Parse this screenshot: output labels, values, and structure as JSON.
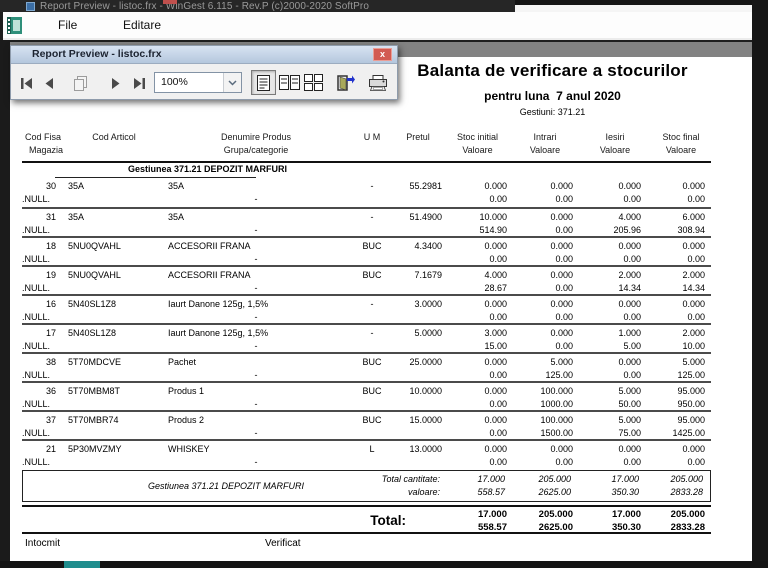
{
  "window": {
    "title": "Report Preview - listoc.frx - WinGest 6.115 - Rev.P  (c)2000-2020 SoftPro",
    "menu": [
      "File",
      "Editare"
    ]
  },
  "preview_toolbar": {
    "title": "Report Preview - listoc.frx",
    "close_label": "x",
    "zoom_value": "100%"
  },
  "report": {
    "title": "Balanta de verificare a stocurilor",
    "subtitle": "pentru luna  7 anul 2020",
    "gestiuni": "Gestiuni: 371.21",
    "header": {
      "row1": [
        "Cod Fisa",
        "Cod Articol",
        "Denumire Produs",
        "U M",
        "Pretul",
        "Stoc initial",
        "Intrari",
        "Iesiri",
        "Stoc final"
      ],
      "row2": [
        "Magazia",
        "",
        "Grupa/categorie",
        "",
        "",
        "Valoare",
        "Valoare",
        "Valoare",
        "Valoare"
      ]
    },
    "group_header": "Gestiunea 371.21  DEPOZIT MARFURI",
    "rows": [
      {
        "fisa": "30",
        "articol": "35A",
        "denumire": "35A",
        "um": "-",
        "pret": "55.2981",
        "si": "0.000",
        "intr": "0.000",
        "iesi": "0.000",
        "sf": "0.000",
        "magazia": ".NULL.",
        "grupa": "-",
        "vi": "0.00",
        "vin": "0.00",
        "vie": "0.00",
        "vsf": "0.00"
      },
      {
        "fisa": "31",
        "articol": "35A",
        "denumire": "35A",
        "um": "-",
        "pret": "51.4900",
        "si": "10.000",
        "intr": "0.000",
        "iesi": "4.000",
        "sf": "6.000",
        "magazia": ".NULL.",
        "grupa": "-",
        "vi": "514.90",
        "vin": "0.00",
        "vie": "205.96",
        "vsf": "308.94"
      },
      {
        "fisa": "18",
        "articol": "5NU0QVAHL",
        "denumire": "ACCESORII FRANA",
        "um": "BUC",
        "pret": "4.3400",
        "si": "0.000",
        "intr": "0.000",
        "iesi": "0.000",
        "sf": "0.000",
        "magazia": ".NULL.",
        "grupa": "-",
        "vi": "0.00",
        "vin": "0.00",
        "vie": "0.00",
        "vsf": "0.00"
      },
      {
        "fisa": "19",
        "articol": "5NU0QVAHL",
        "denumire": "ACCESORII FRANA",
        "um": "BUC",
        "pret": "7.1679",
        "si": "4.000",
        "intr": "0.000",
        "iesi": "2.000",
        "sf": "2.000",
        "magazia": ".NULL.",
        "grupa": "-",
        "vi": "28.67",
        "vin": "0.00",
        "vie": "14.34",
        "vsf": "14.34"
      },
      {
        "fisa": "16",
        "articol": "5N40SL1Z8",
        "denumire": "Iaurt Danone 125g, 1,5%",
        "um": "-",
        "pret": "3.0000",
        "si": "0.000",
        "intr": "0.000",
        "iesi": "0.000",
        "sf": "0.000",
        "magazia": ".NULL.",
        "grupa": "-",
        "vi": "0.00",
        "vin": "0.00",
        "vie": "0.00",
        "vsf": "0.00"
      },
      {
        "fisa": "17",
        "articol": "5N40SL1Z8",
        "denumire": "Iaurt Danone 125g, 1,5%",
        "um": "-",
        "pret": "5.0000",
        "si": "3.000",
        "intr": "0.000",
        "iesi": "1.000",
        "sf": "2.000",
        "magazia": ".NULL.",
        "grupa": "-",
        "vi": "15.00",
        "vin": "0.00",
        "vie": "5.00",
        "vsf": "10.00"
      },
      {
        "fisa": "38",
        "articol": "5T70MDCVE",
        "denumire": "Pachet",
        "um": "BUC",
        "pret": "25.0000",
        "si": "0.000",
        "intr": "5.000",
        "iesi": "0.000",
        "sf": "5.000",
        "magazia": ".NULL.",
        "grupa": "-",
        "vi": "0.00",
        "vin": "125.00",
        "vie": "0.00",
        "vsf": "125.00"
      },
      {
        "fisa": "36",
        "articol": "5T70MBM8T",
        "denumire": "Produs 1",
        "um": "BUC",
        "pret": "10.0000",
        "si": "0.000",
        "intr": "100.000",
        "iesi": "5.000",
        "sf": "95.000",
        "magazia": ".NULL.",
        "grupa": "-",
        "vi": "0.00",
        "vin": "1000.00",
        "vie": "50.00",
        "vsf": "950.00"
      },
      {
        "fisa": "37",
        "articol": "5T70MBR74",
        "denumire": "Produs 2",
        "um": "BUC",
        "pret": "15.0000",
        "si": "0.000",
        "intr": "100.000",
        "iesi": "5.000",
        "sf": "95.000",
        "magazia": ".NULL.",
        "grupa": "-",
        "vi": "0.00",
        "vin": "1500.00",
        "vie": "75.00",
        "vsf": "1425.00"
      },
      {
        "fisa": "21",
        "articol": "5P30MVZMY",
        "denumire": "WHISKEY",
        "um": "L",
        "pret": "13.0000",
        "si": "0.000",
        "intr": "0.000",
        "iesi": "0.000",
        "sf": "0.000",
        "magazia": ".NULL.",
        "grupa": "-",
        "vi": "0.00",
        "vin": "0.00",
        "vie": "0.00",
        "vsf": "0.00"
      }
    ],
    "group_total": {
      "label": "Gestiunea 371.21  DEPOZIT MARFURI",
      "qty_label": "Total cantitate:",
      "val_label": "valoare:",
      "qty": [
        "17.000",
        "205.000",
        "17.000",
        "205.000"
      ],
      "val": [
        "558.57",
        "2625.00",
        "350.30",
        "2833.28"
      ]
    },
    "grand_total": {
      "label": "Total:",
      "qty": [
        "17.000",
        "205.000",
        "17.000",
        "205.000"
      ],
      "val": [
        "558.57",
        "2625.00",
        "350.30",
        "2833.28"
      ]
    },
    "footer": {
      "intocmit": "Intocmit",
      "verificat": "Verificat"
    }
  }
}
